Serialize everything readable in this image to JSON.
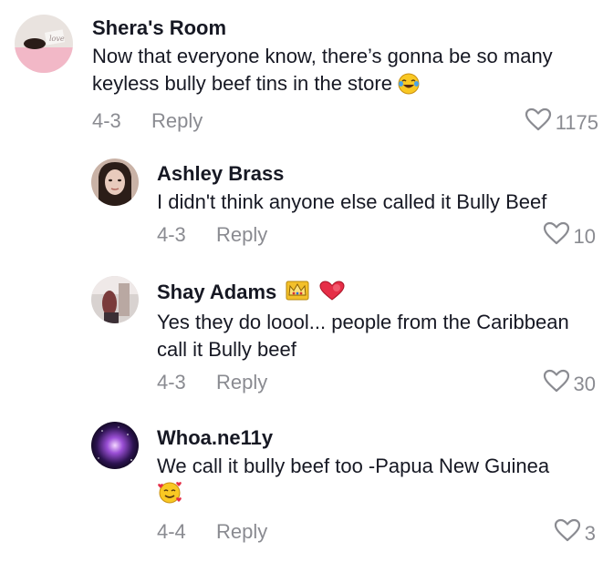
{
  "comments": [
    {
      "username": "Shera's Room",
      "text": "Now that everyone know, there’s gonna be so many keyless bully beef tins in the store",
      "emoji": "face-with-tears-of-joy",
      "date": "4-3",
      "reply_label": "Reply",
      "likes": "1175",
      "avatar_label": "love"
    },
    {
      "username": "Ashley Brass",
      "text": "I didn't think anyone else called it Bully Beef",
      "date": "4-3",
      "reply_label": "Reply",
      "likes": "10"
    },
    {
      "username": "Shay Adams",
      "badges": [
        "crown-emoji",
        "heart-emoji"
      ],
      "text": "Yes they do loool... people from the Caribbean call it Bully beef",
      "date": "4-3",
      "reply_label": "Reply",
      "likes": "30"
    },
    {
      "username": "Whoa.ne11y",
      "text": "We call it bully beef too -Papua New Guinea",
      "emoji": "smiling-face-with-hearts",
      "date": "4-4",
      "reply_label": "Reply",
      "likes": "3"
    }
  ],
  "colors": {
    "text_primary": "#161823",
    "text_secondary": "#8a8b91"
  }
}
